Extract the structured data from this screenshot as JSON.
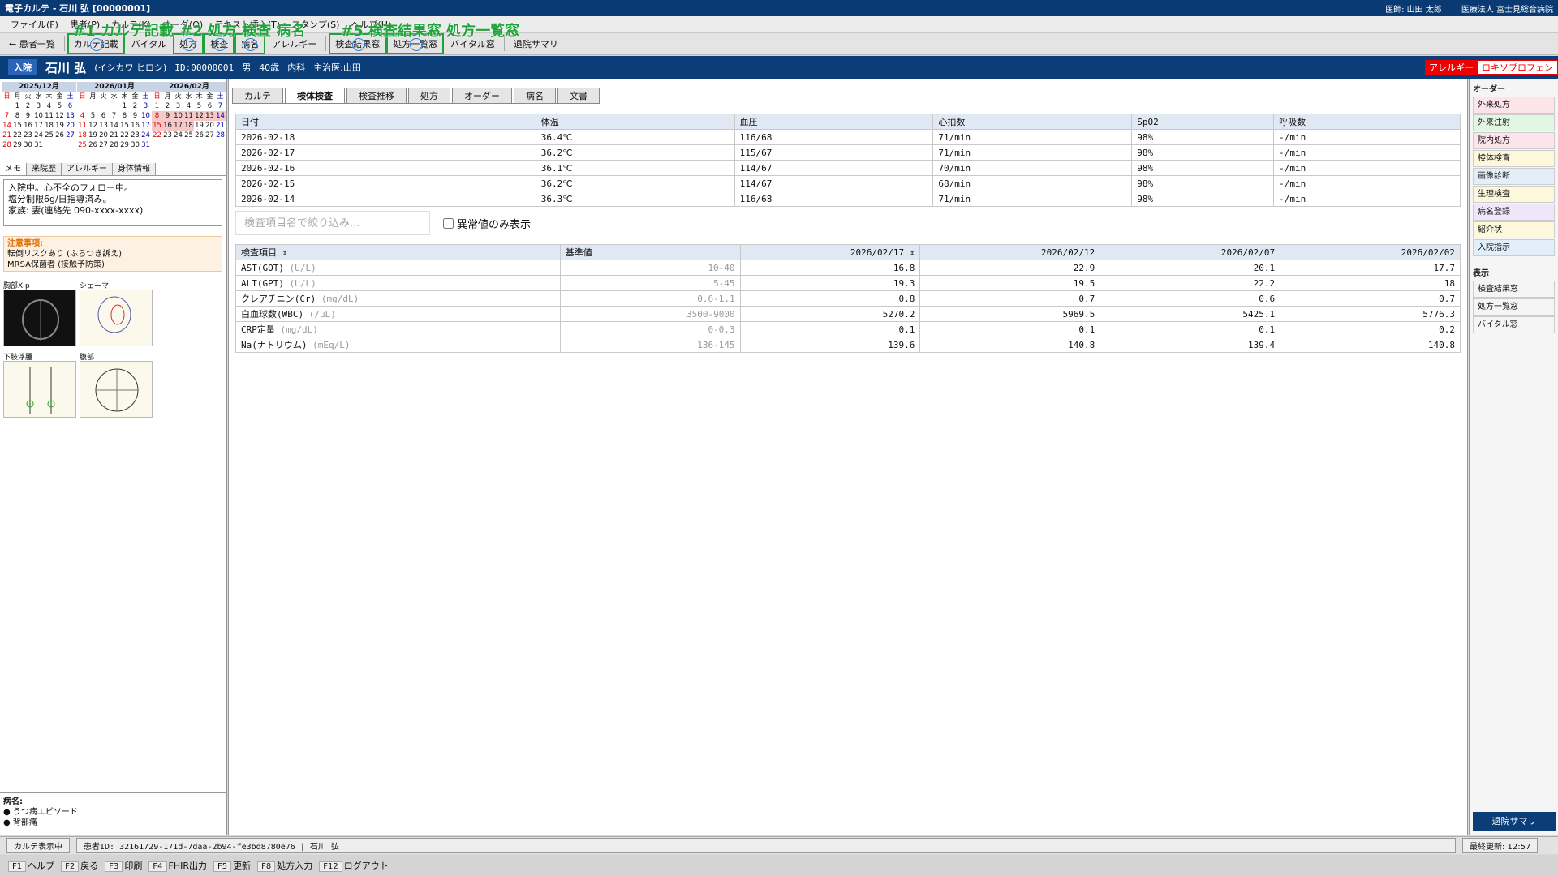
{
  "window": {
    "title": "電子カルテ - 石川 弘 [00000001]",
    "doctor": "医師: 山田 太郎",
    "hospital": "医療法人 富士見総合病院"
  },
  "menu": [
    "ファイル(F)",
    "患者(P)",
    "カルテ(K)",
    "オーダ(O)",
    "テキスト挿入(T)",
    "スタンプ(S)",
    "ヘルプ(H)"
  ],
  "toolbar": {
    "back": "← 患者一覧",
    "karte_write": "カルテ記載",
    "vital": "バイタル",
    "prescription": "処方",
    "exam": "検査",
    "disease": "病名",
    "allergy": "アレルギー",
    "lab_window": "検査結果窓",
    "rx_list": "処方一覧窓",
    "vital_window": "バイタル窓",
    "discharge": "退院サマリ"
  },
  "annotations": {
    "a1": "#1 カルテ記載",
    "a2": "#2 処方 検査 病名",
    "a5": "#5 検査結果窓 処方一覧窓"
  },
  "patient": {
    "status": "入院",
    "name": "石川 弘",
    "kana": "(イシカワ ヒロシ)",
    "id": "ID:00000001",
    "sex": "男",
    "age": "40歳",
    "dept": "内科",
    "attending": "主治医:山田",
    "allergy_label": "アレルギー",
    "allergy_drug": "ロキソプロフェン"
  },
  "calendar": {
    "weekdays": [
      "日",
      "月",
      "火",
      "水",
      "木",
      "金",
      "土"
    ],
    "months": [
      {
        "title": "2025/12月",
        "days": [
          "",
          "1",
          "2",
          "3",
          "4",
          "5",
          "6",
          "7",
          "8",
          "9",
          "10",
          "11",
          "12",
          "13",
          "14",
          "15",
          "16",
          "17",
          "18",
          "19",
          "20",
          "21",
          "22",
          "23",
          "24",
          "25",
          "26",
          "27",
          "28",
          "29",
          "30",
          "31"
        ]
      },
      {
        "title": "2026/01月",
        "days": [
          "",
          "",
          "",
          "",
          "1",
          "2",
          "3",
          "4",
          "5",
          "6",
          "7",
          "8",
          "9",
          "10",
          "11",
          "12",
          "13",
          "14",
          "15",
          "16",
          "17",
          "18",
          "19",
          "20",
          "21",
          "22",
          "23",
          "24",
          "25",
          "26",
          "27",
          "28",
          "29",
          "30",
          "31"
        ]
      },
      {
        "title": "2026/02月",
        "days": [
          "1",
          "2",
          "3",
          "4",
          "5",
          "6",
          "7",
          "8",
          "9",
          "10",
          "11",
          "12",
          "13",
          "14",
          "15",
          "16",
          "17",
          "18",
          "19",
          "20",
          "21",
          "22",
          "23",
          "24",
          "25",
          "26",
          "27",
          "28"
        ]
      }
    ]
  },
  "left_tabs": [
    "メモ",
    "来院歴",
    "アレルギー",
    "身体情報"
  ],
  "memo": [
    "入院中。心不全のフォロー中。",
    "塩分制限6g/日指導済み。",
    "家族: 妻(連絡先 090-xxxx-xxxx)"
  ],
  "caution": {
    "title": "注意事項:",
    "lines": [
      "転倒リスクあり (ふらつき訴え)",
      "MRSA保菌者 (接触予防策)"
    ]
  },
  "schemas": [
    {
      "label": "胸部X-p"
    },
    {
      "label": "シェーマ"
    },
    {
      "label": "下肢浮腫"
    },
    {
      "label": "腹部"
    }
  ],
  "diseases": {
    "title": "病名:",
    "items": [
      "うつ病エピソード",
      "背部痛"
    ]
  },
  "main_tabs": [
    "カルテ",
    "検体検査",
    "検査推移",
    "処方",
    "オーダー",
    "病名",
    "文書"
  ],
  "vitals": {
    "headers": [
      "日付",
      "体温",
      "血圧",
      "心拍数",
      "SpO2",
      "呼吸数"
    ],
    "rows": [
      [
        "2026-02-18",
        "36.4℃",
        "116/68",
        "71/min",
        "98%",
        "-/min"
      ],
      [
        "2026-02-17",
        "36.2℃",
        "115/67",
        "71/min",
        "98%",
        "-/min"
      ],
      [
        "2026-02-16",
        "36.1℃",
        "114/67",
        "70/min",
        "98%",
        "-/min"
      ],
      [
        "2026-02-15",
        "36.2℃",
        "114/67",
        "68/min",
        "98%",
        "-/min"
      ],
      [
        "2026-02-14",
        "36.3℃",
        "116/68",
        "71/min",
        "98%",
        "-/min"
      ]
    ]
  },
  "filter": {
    "placeholder": "検査項目名で絞り込み...",
    "abnormal_only": "異常値のみ表示"
  },
  "labs": {
    "headers": [
      "検査項目 ↕",
      "基準値",
      "2026/02/17 ↕",
      "2026/02/12",
      "2026/02/07",
      "2026/02/02"
    ],
    "rows": [
      {
        "name": "AST(GOT)",
        "unit": "(U/L)",
        "ref": "10-40",
        "vals": [
          "16.8",
          "22.9",
          "20.1",
          "17.7"
        ]
      },
      {
        "name": "ALT(GPT)",
        "unit": "(U/L)",
        "ref": "5-45",
        "vals": [
          "19.3",
          "19.5",
          "22.2",
          "18"
        ]
      },
      {
        "name": "クレアチニン(Cr)",
        "unit": "(mg/dL)",
        "ref": "0.6-1.1",
        "vals": [
          "0.8",
          "0.7",
          "0.6",
          "0.7"
        ]
      },
      {
        "name": "白血球数(WBC)",
        "unit": "(/μL)",
        "ref": "3500-9000",
        "vals": [
          "5270.2",
          "5969.5",
          "5425.1",
          "5776.3"
        ]
      },
      {
        "name": "CRP定量",
        "unit": "(mg/dL)",
        "ref": "0-0.3",
        "vals": [
          "0.1",
          "0.1",
          "0.1",
          "0.2"
        ]
      },
      {
        "name": "Na(ナトリウム)",
        "unit": "(mEq/L)",
        "ref": "136-145",
        "vals": [
          "139.6",
          "140.8",
          "139.4",
          "140.8"
        ]
      }
    ]
  },
  "right_panel": {
    "order_title": "オーダー",
    "orders": [
      {
        "label": "外来処方",
        "color": "#fde3ea"
      },
      {
        "label": "外来注射",
        "color": "#e3f6e3"
      },
      {
        "label": "院内処方",
        "color": "#fde3ea"
      },
      {
        "label": "検体検査",
        "color": "#fdf8dc"
      },
      {
        "label": "画像診断",
        "color": "#e3eefb"
      },
      {
        "label": "生理検査",
        "color": "#fdf8dc"
      },
      {
        "label": "病名登録",
        "color": "#f0e6fa"
      },
      {
        "label": "紹介状",
        "color": "#fdf8dc"
      },
      {
        "label": "入院指示",
        "color": "#e3eefb"
      }
    ],
    "display_title": "表示",
    "displays": [
      "検査結果窓",
      "処方一覧窓",
      "バイタル窓"
    ],
    "discharge": "退院サマリ"
  },
  "status": {
    "mode": "カルテ表示中",
    "patient_id": "患者ID: 32161729-171d-7daa-2b94-fe3bd8780e76 | 石川 弘",
    "last_update": "最終更新: 12:57"
  },
  "fkeys": [
    {
      "key": "F1",
      "label": "ヘルプ"
    },
    {
      "key": "F2",
      "label": "戻る"
    },
    {
      "key": "F3",
      "label": "印刷"
    },
    {
      "key": "F4",
      "label": "FHIR出力"
    },
    {
      "key": "F5",
      "label": "更新"
    },
    {
      "key": "F8",
      "label": "処方入力"
    },
    {
      "key": "F12",
      "label": "ログアウト"
    }
  ]
}
